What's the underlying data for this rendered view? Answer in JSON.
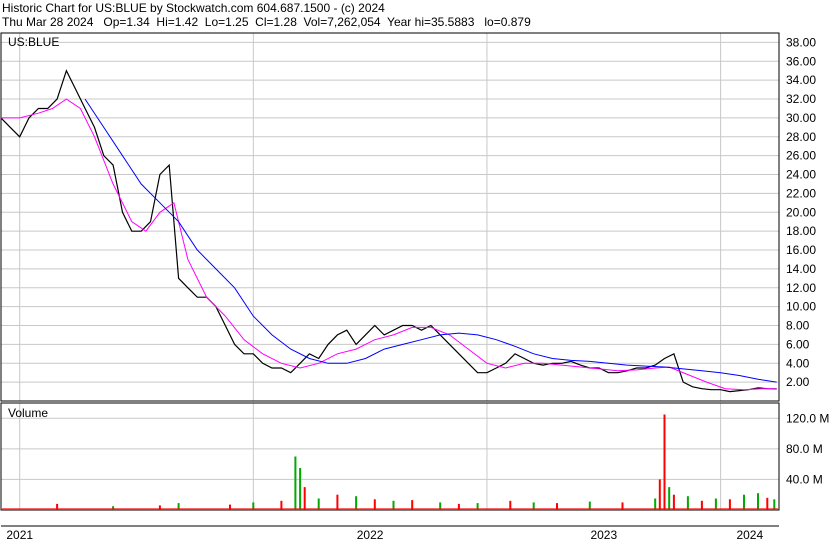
{
  "header": {
    "line1": "Historic Chart for US:BLUE by Stockwatch.com 604.687.1500 - (c) 2024",
    "line2": "Thu Mar 28 2024   Op=1.34  Hi=1.42  Lo=1.25  Cl=1.28  Vol=7,262,054  Year hi=35.5883   lo=0.879"
  },
  "colors": {
    "price": "#000000",
    "ma_short": "#ff00ff",
    "ma_long": "#0000ff",
    "volume_up": "#00aa00",
    "volume_down": "#ff0000",
    "grid": "#c8c8c8"
  },
  "chart_data": [
    {
      "type": "line",
      "title": "US:BLUE",
      "ylim": [
        0,
        39
      ],
      "yticks": [
        2,
        4,
        6,
        8,
        10,
        12,
        14,
        16,
        18,
        20,
        22,
        24,
        26,
        28,
        30,
        32,
        34,
        36,
        38
      ],
      "ytick_labels": [
        "2.00",
        "4.00",
        "6.00",
        "8.00",
        "10.00",
        "12.00",
        "14.00",
        "16.00",
        "18.00",
        "20.00",
        "22.00",
        "24.00",
        "26.00",
        "28.00",
        "30.00",
        "32.00",
        "34.00",
        "36.00",
        "38.00"
      ],
      "xlim": [
        2020.92,
        2024.25
      ],
      "x_tick_labels": [
        {
          "label": "2021",
          "year": 2021.0,
          "boundary": 2021.0
        },
        {
          "label": "2022",
          "year": 2022.0,
          "boundary": 2022.0
        },
        {
          "label": "2023",
          "year": 2023.0,
          "boundary": 2023.0
        },
        {
          "label": "2024",
          "year": 2024.0,
          "boundary": 2024.0
        }
      ],
      "grid": true,
      "series": [
        {
          "key": "price",
          "x": [
            2020.92,
            2020.96,
            2021.0,
            2021.04,
            2021.08,
            2021.12,
            2021.16,
            2021.2,
            2021.24,
            2021.28,
            2021.32,
            2021.36,
            2021.4,
            2021.44,
            2021.48,
            2021.52,
            2021.56,
            2021.6,
            2021.64,
            2021.68,
            2021.72,
            2021.76,
            2021.8,
            2021.84,
            2021.88,
            2021.92,
            2021.96,
            2022.0,
            2022.04,
            2022.08,
            2022.12,
            2022.16,
            2022.2,
            2022.24,
            2022.28,
            2022.32,
            2022.36,
            2022.4,
            2022.44,
            2022.48,
            2022.52,
            2022.56,
            2022.6,
            2022.64,
            2022.68,
            2022.72,
            2022.76,
            2022.8,
            2022.84,
            2022.88,
            2022.92,
            2022.96,
            2023.0,
            2023.04,
            2023.08,
            2023.12,
            2023.16,
            2023.2,
            2023.24,
            2023.28,
            2023.32,
            2023.36,
            2023.4,
            2023.44,
            2023.48,
            2023.52,
            2023.56,
            2023.6,
            2023.64,
            2023.68,
            2023.72,
            2023.76,
            2023.8,
            2023.84,
            2023.88,
            2023.92,
            2023.96,
            2024.0,
            2024.04,
            2024.08,
            2024.12,
            2024.16,
            2024.2,
            2024.24
          ],
          "values": [
            30,
            29,
            28,
            30,
            31,
            31,
            32,
            35,
            33,
            31,
            29,
            26,
            25,
            20,
            18,
            18,
            19,
            24,
            25,
            13,
            12,
            11,
            11,
            10,
            8,
            6,
            5,
            5,
            4,
            3.5,
            3.5,
            3,
            4,
            5,
            4.5,
            6,
            7,
            7.5,
            6,
            7,
            8,
            7,
            7.5,
            8,
            8,
            7.5,
            8,
            7,
            6,
            5,
            4,
            3,
            3,
            3.5,
            4,
            5,
            4.5,
            4,
            3.8,
            4,
            4,
            4.2,
            3.8,
            3.5,
            3.5,
            3,
            3,
            3.2,
            3.5,
            3.5,
            3.8,
            4.5,
            5,
            2,
            1.5,
            1.3,
            1.2,
            1.2,
            1.0,
            1.1,
            1.2,
            1.4,
            1.3,
            1.28
          ]
        },
        {
          "key": "ma_short",
          "x": [
            2020.92,
            2021.0,
            2021.08,
            2021.14,
            2021.2,
            2021.26,
            2021.32,
            2021.4,
            2021.48,
            2021.54,
            2021.6,
            2021.66,
            2021.72,
            2021.8,
            2021.88,
            2021.96,
            2022.04,
            2022.12,
            2022.2,
            2022.28,
            2022.36,
            2022.44,
            2022.52,
            2022.6,
            2022.68,
            2022.76,
            2022.84,
            2022.92,
            2023.0,
            2023.08,
            2023.16,
            2023.24,
            2023.32,
            2023.4,
            2023.48,
            2023.56,
            2023.64,
            2023.72,
            2023.78,
            2023.86,
            2023.94,
            2024.02,
            2024.1,
            2024.18,
            2024.24
          ],
          "values": [
            30,
            30,
            30.5,
            31,
            32,
            31,
            28,
            23,
            19,
            18,
            20,
            21,
            15,
            11,
            9,
            6.5,
            5,
            4,
            3.5,
            4,
            5,
            5.5,
            6.5,
            7,
            7.8,
            7.8,
            7,
            5.5,
            4,
            3.5,
            4,
            4,
            3.8,
            3.6,
            3.4,
            3.2,
            3.3,
            3.5,
            3.6,
            2.8,
            2,
            1.3,
            1.2,
            1.3,
            1.3
          ]
        },
        {
          "key": "ma_long",
          "x": [
            2021.28,
            2021.36,
            2021.44,
            2021.52,
            2021.6,
            2021.68,
            2021.76,
            2021.84,
            2021.92,
            2022.0,
            2022.08,
            2022.16,
            2022.24,
            2022.32,
            2022.4,
            2022.48,
            2022.56,
            2022.64,
            2022.72,
            2022.8,
            2022.88,
            2022.96,
            2023.04,
            2023.12,
            2023.2,
            2023.28,
            2023.36,
            2023.44,
            2023.52,
            2023.6,
            2023.68,
            2023.76,
            2023.84,
            2023.92,
            2024.0,
            2024.08,
            2024.16,
            2024.24
          ],
          "values": [
            32,
            29,
            26,
            23,
            21,
            19,
            16,
            14,
            12,
            9,
            7,
            5.5,
            4.5,
            4,
            4,
            4.5,
            5.5,
            6,
            6.5,
            7,
            7.2,
            7,
            6.5,
            5.8,
            5,
            4.5,
            4.3,
            4.2,
            4.0,
            3.8,
            3.7,
            3.6,
            3.4,
            3.2,
            3.0,
            2.7,
            2.3,
            2.0
          ]
        }
      ]
    },
    {
      "type": "bar",
      "title": "Volume",
      "ylim": [
        0,
        140
      ],
      "yticks": [
        40,
        80,
        120
      ],
      "ytick_labels": [
        "40.0 M",
        "80.0 M",
        "120.0 M"
      ],
      "xlim": [
        2020.92,
        2024.25
      ],
      "spikes": [
        {
          "x": 2021.16,
          "value": 8,
          "dir": "down"
        },
        {
          "x": 2021.4,
          "value": 5,
          "dir": "up"
        },
        {
          "x": 2021.6,
          "value": 6,
          "dir": "down"
        },
        {
          "x": 2021.68,
          "value": 9,
          "dir": "up"
        },
        {
          "x": 2021.9,
          "value": 7,
          "dir": "down"
        },
        {
          "x": 2022.0,
          "value": 10,
          "dir": "up"
        },
        {
          "x": 2022.12,
          "value": 12,
          "dir": "down"
        },
        {
          "x": 2022.18,
          "value": 70,
          "dir": "up"
        },
        {
          "x": 2022.2,
          "value": 55,
          "dir": "up"
        },
        {
          "x": 2022.22,
          "value": 30,
          "dir": "down"
        },
        {
          "x": 2022.28,
          "value": 15,
          "dir": "up"
        },
        {
          "x": 2022.36,
          "value": 20,
          "dir": "down"
        },
        {
          "x": 2022.44,
          "value": 18,
          "dir": "up"
        },
        {
          "x": 2022.52,
          "value": 14,
          "dir": "down"
        },
        {
          "x": 2022.6,
          "value": 12,
          "dir": "up"
        },
        {
          "x": 2022.68,
          "value": 13,
          "dir": "down"
        },
        {
          "x": 2022.8,
          "value": 10,
          "dir": "up"
        },
        {
          "x": 2022.88,
          "value": 8,
          "dir": "down"
        },
        {
          "x": 2022.96,
          "value": 9,
          "dir": "up"
        },
        {
          "x": 2023.1,
          "value": 12,
          "dir": "down"
        },
        {
          "x": 2023.2,
          "value": 10,
          "dir": "up"
        },
        {
          "x": 2023.3,
          "value": 9,
          "dir": "down"
        },
        {
          "x": 2023.44,
          "value": 11,
          "dir": "up"
        },
        {
          "x": 2023.58,
          "value": 10,
          "dir": "down"
        },
        {
          "x": 2023.72,
          "value": 15,
          "dir": "up"
        },
        {
          "x": 2023.74,
          "value": 40,
          "dir": "down"
        },
        {
          "x": 2023.76,
          "value": 125,
          "dir": "down"
        },
        {
          "x": 2023.78,
          "value": 30,
          "dir": "up"
        },
        {
          "x": 2023.8,
          "value": 20,
          "dir": "down"
        },
        {
          "x": 2023.86,
          "value": 18,
          "dir": "up"
        },
        {
          "x": 2023.92,
          "value": 12,
          "dir": "down"
        },
        {
          "x": 2023.98,
          "value": 15,
          "dir": "up"
        },
        {
          "x": 2024.04,
          "value": 14,
          "dir": "down"
        },
        {
          "x": 2024.1,
          "value": 20,
          "dir": "up"
        },
        {
          "x": 2024.16,
          "value": 22,
          "dir": "up"
        },
        {
          "x": 2024.2,
          "value": 16,
          "dir": "down"
        },
        {
          "x": 2024.23,
          "value": 14,
          "dir": "up"
        }
      ]
    }
  ]
}
